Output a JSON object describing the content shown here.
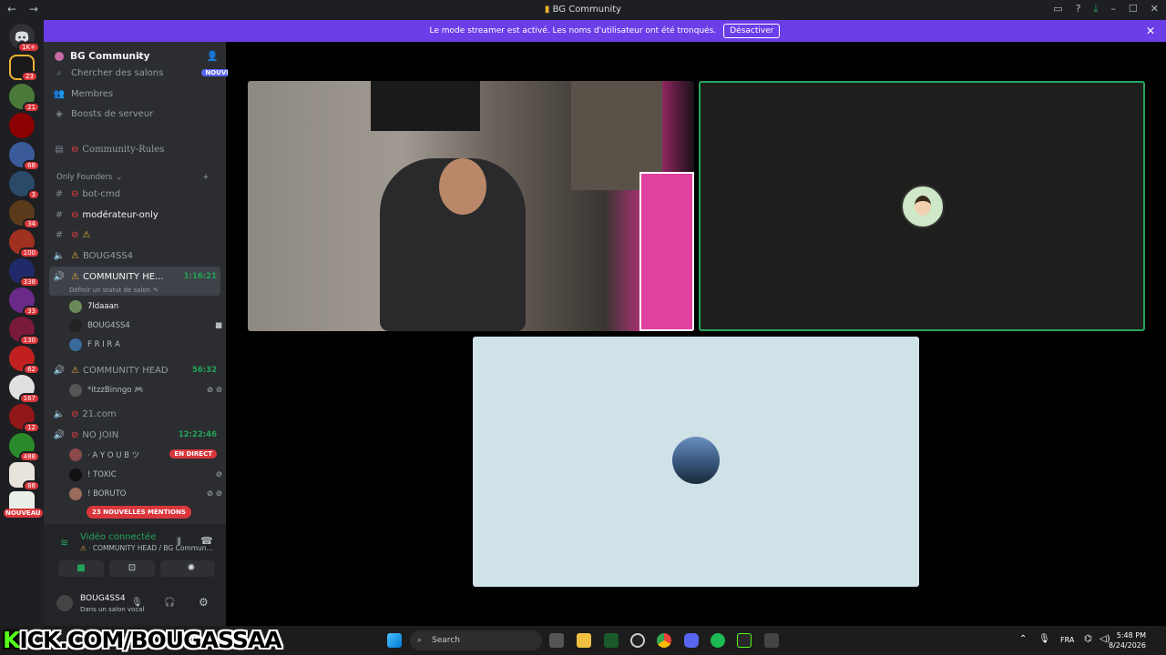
{
  "window": {
    "title": "BG Community",
    "back": "←",
    "forward": "→",
    "controls": [
      "–",
      "☐",
      "✕"
    ]
  },
  "banner": {
    "text": "Le mode streamer est activé. Les noms d'utilisateur ont été tronqués.",
    "button": "Désactiver"
  },
  "servers": {
    "badges": [
      "1K+",
      "23",
      "21",
      "",
      "68",
      "3",
      "34",
      "100",
      "338",
      "33",
      "130",
      "62",
      "167",
      "12",
      "488",
      "88"
    ],
    "new_label": "NOUVEAU"
  },
  "sidebar": {
    "server_name": "BG Community",
    "search_channels": "Chercher des salons",
    "search_badge": "NOUVEAU",
    "members": "Membres",
    "boosts": "Boosts de serveur",
    "rules": "Community-Rules",
    "category": "Only Founders",
    "channels": {
      "bot": "bot-cmd",
      "mod": "modérateur-only",
      "warn_only": "",
      "boug": "BOUG4SS4",
      "community_active": "COMMUNITY HE...",
      "community_active_timer": "1:16:21",
      "set_status": "Définir un statut de salon",
      "community2": "COMMUNITY HEAD",
      "community2_timer": "56:32",
      "c21": "21.com",
      "nojoin": "NO JOIN",
      "nojoin_timer": "12:22:46"
    },
    "users_active": [
      "7ldaaan",
      "BOUG4SS4",
      "F R I R A"
    ],
    "users_c2": [
      "*itzzBinngo 🎮"
    ],
    "users_nojoin": [
      "· A Y O U B ツ",
      "! TOXIC",
      "! BORUTO"
    ],
    "live_label": "EN DIRECT",
    "mentions": "23 NOUVELLES MENTIONS"
  },
  "voice": {
    "status": "Vidéo connectée",
    "location": "COMMUNITY HEAD / BG Commun...",
    "username": "BOUG4SS4",
    "user_status": "Dans un salon vocal"
  },
  "taskbar": {
    "kick": "KICK.COM/BOUGASSAA",
    "kick_k": "K",
    "search": "Search",
    "lang": "FRA",
    "time": "5:48 PM",
    "date": "8/24/2026"
  },
  "colors": {
    "brand": "#5865f2",
    "banner": "#6b3ee8",
    "green": "#23a55a",
    "red": "#da373c",
    "kick": "#53fc18"
  }
}
